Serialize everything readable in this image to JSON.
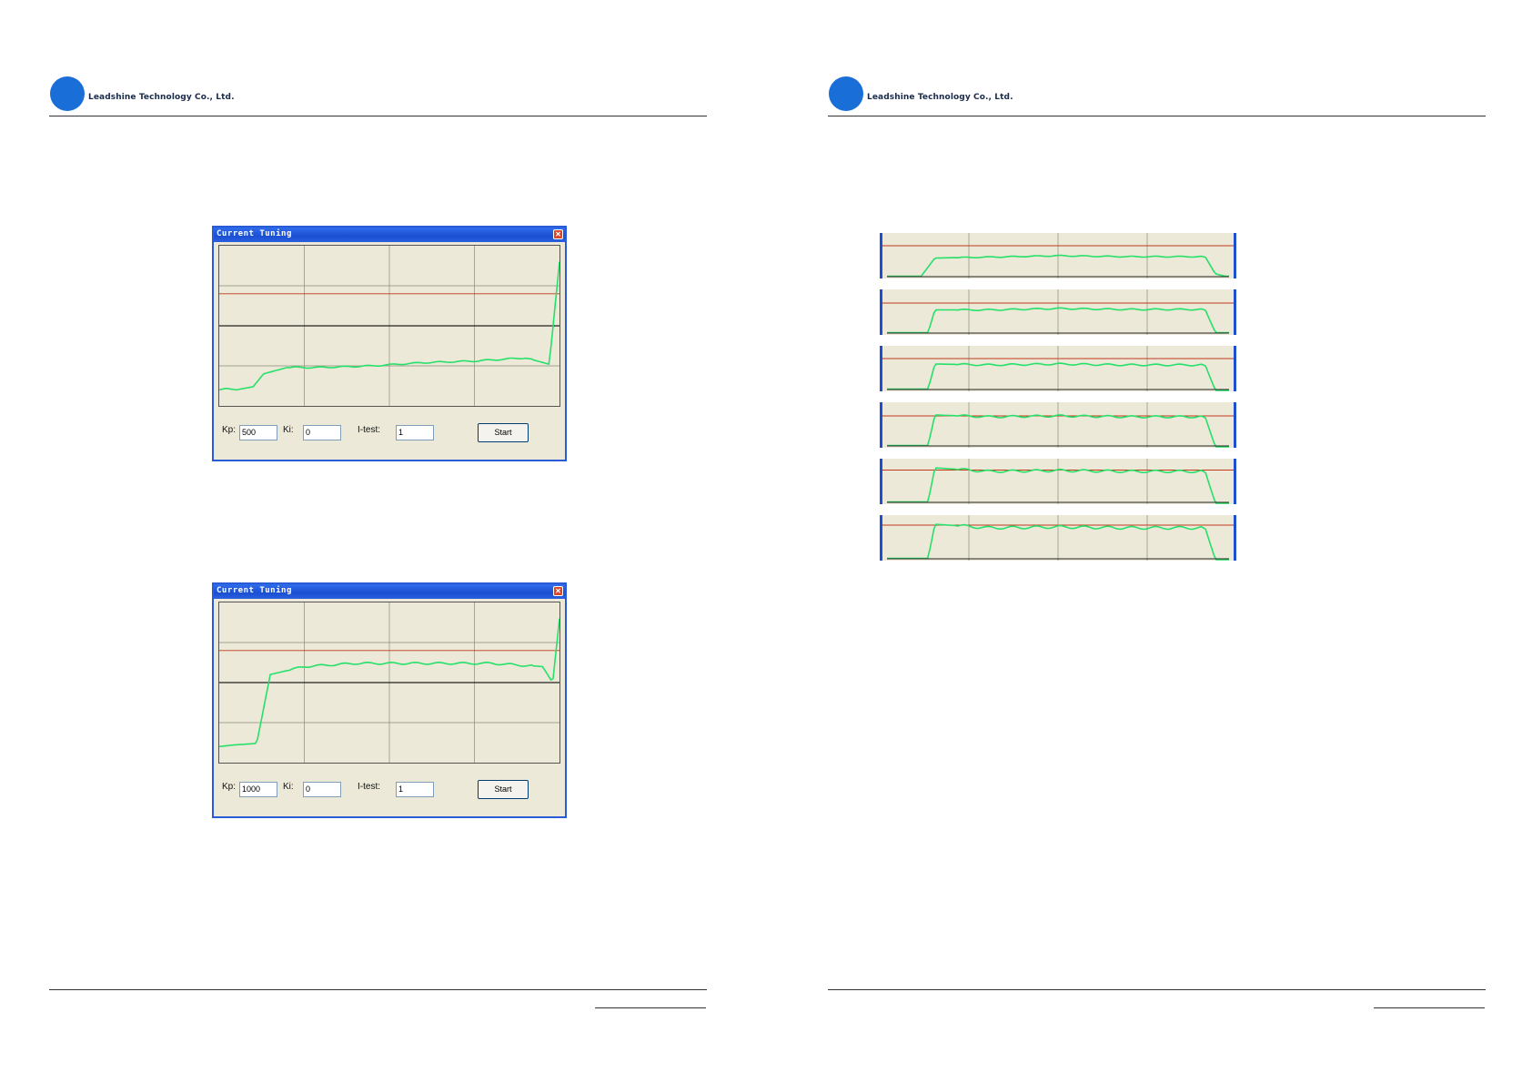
{
  "header": {
    "company": "Leadshine Technology Co., Ltd."
  },
  "windows": [
    {
      "title": "Current Tuning",
      "close_symbol": "✕",
      "kp_label": "Kp:",
      "kp_value": "500",
      "ki_label": "Ki:",
      "ki_value": "0",
      "itest_label": "I-test:",
      "itest_value": "1",
      "start_label": "Start"
    },
    {
      "title": "Current Tuning",
      "close_symbol": "✕",
      "kp_label": "Kp:",
      "kp_value": "1000",
      "ki_label": "Ki:",
      "ki_value": "0",
      "itest_label": "I-test:",
      "itest_value": "1",
      "start_label": "Start"
    }
  ],
  "colors": {
    "trace": "#27e06a",
    "reference": "#c0391b",
    "grid": "#8a8a7a",
    "window_bg": "#ece9d8",
    "title_blue": "#1c4fd2",
    "logo_blue": "#1a6ed8"
  },
  "chart_data": [
    {
      "type": "line",
      "title": "",
      "ylabel": "",
      "xlabel": "",
      "description_series": [
        "response"
      ],
      "reference_level": 0.7,
      "response": [
        [
          0,
          0.1
        ],
        [
          0.02,
          0.11
        ],
        [
          0.05,
          0.1
        ],
        [
          0.1,
          0.12
        ],
        [
          0.13,
          0.2
        ],
        [
          0.2,
          0.24
        ],
        [
          0.3,
          0.24
        ],
        [
          0.45,
          0.25
        ],
        [
          0.6,
          0.27
        ],
        [
          0.75,
          0.28
        ],
        [
          0.9,
          0.3
        ],
        [
          0.97,
          0.26
        ],
        [
          1.0,
          0.9
        ]
      ]
    },
    {
      "type": "line",
      "title": "",
      "reference_level": 0.7,
      "response": [
        [
          0,
          0.1
        ],
        [
          0.04,
          0.11
        ],
        [
          0.11,
          0.12
        ],
        [
          0.15,
          0.55
        ],
        [
          0.25,
          0.6
        ],
        [
          0.4,
          0.62
        ],
        [
          0.6,
          0.62
        ],
        [
          0.8,
          0.62
        ],
        [
          0.95,
          0.6
        ],
        [
          0.98,
          0.5
        ],
        [
          1.0,
          0.9
        ]
      ]
    },
    {
      "type": "line",
      "title": "",
      "reference_level": 0.72,
      "response": [
        [
          0,
          0.05
        ],
        [
          0.1,
          0.05
        ],
        [
          0.14,
          0.45
        ],
        [
          0.3,
          0.47
        ],
        [
          0.5,
          0.5
        ],
        [
          0.7,
          0.48
        ],
        [
          0.93,
          0.48
        ],
        [
          0.96,
          0.1
        ],
        [
          0.99,
          0.05
        ]
      ]
    },
    {
      "type": "line",
      "title": "",
      "reference_level": 0.7,
      "response": [
        [
          0,
          0.05
        ],
        [
          0.12,
          0.05
        ],
        [
          0.14,
          0.55
        ],
        [
          0.3,
          0.55
        ],
        [
          0.5,
          0.58
        ],
        [
          0.7,
          0.56
        ],
        [
          0.93,
          0.56
        ],
        [
          0.96,
          0.05
        ]
      ]
    },
    {
      "type": "line",
      "title": "",
      "reference_level": 0.72,
      "response": [
        [
          0,
          0.05
        ],
        [
          0.12,
          0.05
        ],
        [
          0.14,
          0.6
        ],
        [
          0.3,
          0.58
        ],
        [
          0.5,
          0.6
        ],
        [
          0.7,
          0.58
        ],
        [
          0.93,
          0.58
        ],
        [
          0.96,
          0.02
        ]
      ]
    },
    {
      "type": "line",
      "title": "",
      "reference_level": 0.7,
      "response": [
        [
          0,
          0.05
        ],
        [
          0.12,
          0.05
        ],
        [
          0.14,
          0.72
        ],
        [
          0.3,
          0.68
        ],
        [
          0.5,
          0.7
        ],
        [
          0.7,
          0.68
        ],
        [
          0.93,
          0.68
        ],
        [
          0.96,
          0.02
        ]
      ]
    },
    {
      "type": "line",
      "title": "",
      "reference_level": 0.75,
      "response": [
        [
          0,
          0.05
        ],
        [
          0.12,
          0.05
        ],
        [
          0.14,
          0.8
        ],
        [
          0.3,
          0.72
        ],
        [
          0.5,
          0.74
        ],
        [
          0.7,
          0.72
        ],
        [
          0.93,
          0.72
        ],
        [
          0.96,
          0.02
        ]
      ]
    },
    {
      "type": "line",
      "title": "",
      "reference_level": 0.78,
      "response": [
        [
          0,
          0.05
        ],
        [
          0.12,
          0.05
        ],
        [
          0.14,
          0.8
        ],
        [
          0.3,
          0.72
        ],
        [
          0.5,
          0.74
        ],
        [
          0.7,
          0.72
        ],
        [
          0.93,
          0.72
        ],
        [
          0.96,
          0.02
        ]
      ]
    }
  ]
}
